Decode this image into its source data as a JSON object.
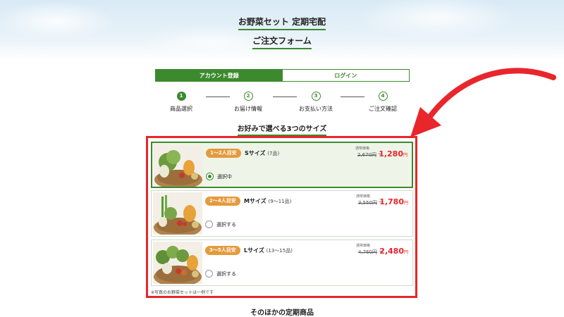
{
  "header": {
    "title_line1": "お野菜セット 定期宅配",
    "title_line2": "ご注文フォーム"
  },
  "tabs": [
    {
      "label": "アカウント登録",
      "active": true
    },
    {
      "label": "ログイン",
      "active": false
    }
  ],
  "steps": [
    {
      "number": "1",
      "label": "商品選択",
      "done": true
    },
    {
      "number": "2",
      "label": "お届け情報",
      "done": false
    },
    {
      "number": "3",
      "label": "お支払い方法",
      "done": false
    },
    {
      "number": "4",
      "label": "ご注文確認",
      "done": false
    }
  ],
  "section_title": "お好みで選べる3つのサイズ",
  "sizes": [
    {
      "badge": "1〜2人目安",
      "name": "Sサイズ",
      "count": "(7品)",
      "regular_label": "通常価格",
      "old_price": "2,670円",
      "new_price": "1,280",
      "yen": "円",
      "radio_label": "選択中",
      "selected": true
    },
    {
      "badge": "2〜4人目安",
      "name": "Mサイズ",
      "count": "(9〜11品)",
      "regular_label": "通常価格",
      "old_price": "3,550円",
      "new_price": "1,780",
      "yen": "円",
      "radio_label": "選択する",
      "selected": false
    },
    {
      "badge": "3〜5人目安",
      "name": "Lサイズ",
      "count": "(13〜15品)",
      "regular_label": "通常価格",
      "old_price": "4,760円",
      "new_price": "2,480",
      "yen": "円",
      "radio_label": "選択する",
      "selected": false
    }
  ],
  "photo_note": "※写真のお野菜セットは一例です",
  "other_products_title": "そのほかの定期商品",
  "colors": {
    "accent_green": "#3c8a2e",
    "highlight_red": "#e8262b",
    "badge_orange": "#e59a3c"
  }
}
